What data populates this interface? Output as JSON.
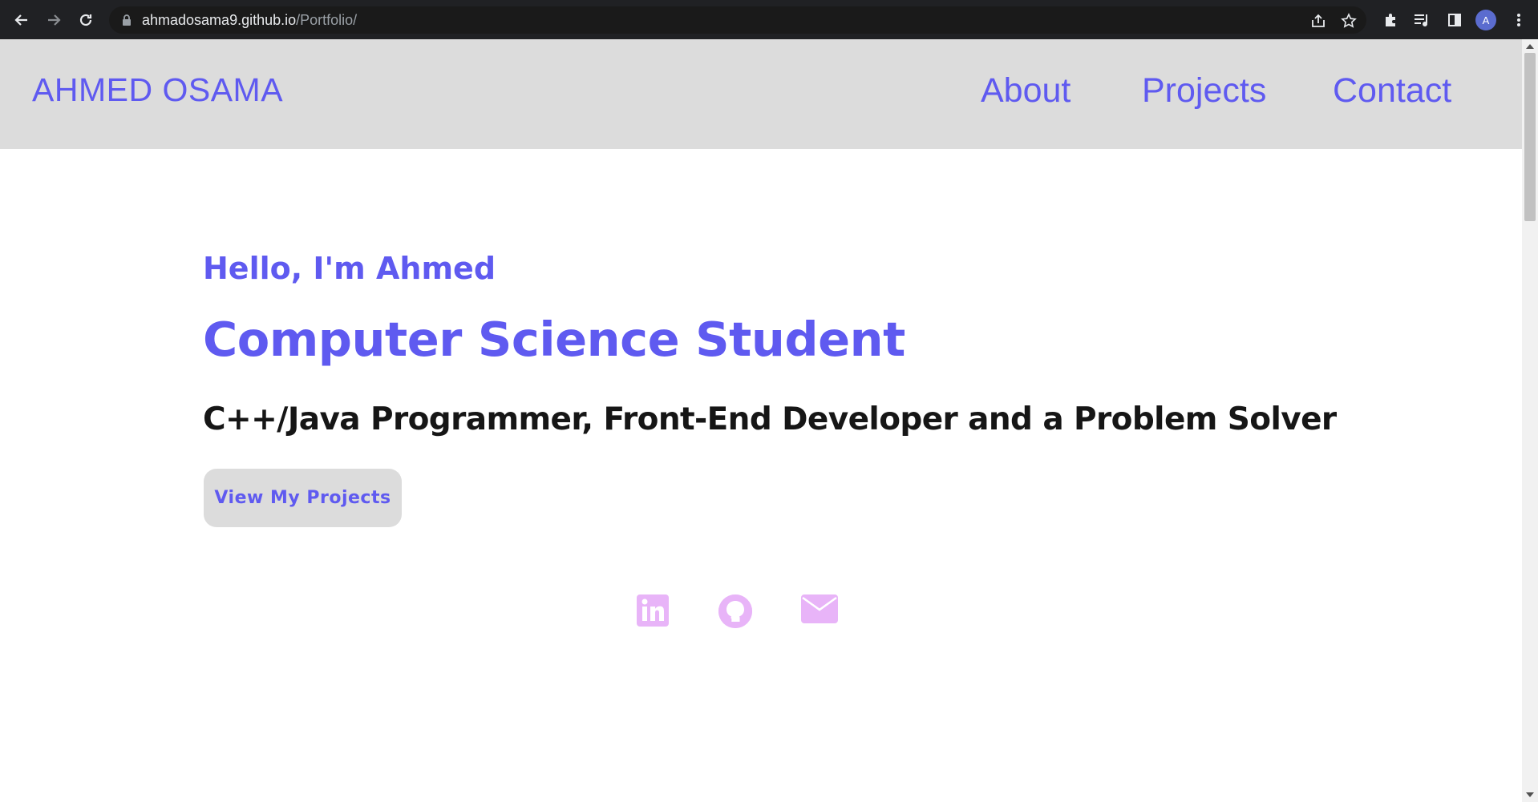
{
  "browser": {
    "url_host": "ahmadosama9.github.io",
    "url_path": "/Portfolio/",
    "profile_initial": "A"
  },
  "site": {
    "logo": "AHMED OSAMA",
    "nav": [
      {
        "label": "About"
      },
      {
        "label": "Projects"
      },
      {
        "label": "Contact"
      }
    ]
  },
  "hero": {
    "greeting": "Hello, I'm Ahmed",
    "title": "Computer Science Student",
    "subtitle": "C++/Java Programmer, Front-End Developer and a Problem Solver",
    "cta_label": "View My Projects"
  },
  "social": [
    {
      "icon": "linkedin-icon"
    },
    {
      "icon": "github-icon"
    },
    {
      "icon": "mail-icon"
    }
  ],
  "colors": {
    "accent": "#5f5af0",
    "nav_bg": "#dcdcdc",
    "social_icon": "#e8b4f8",
    "subtitle": "#161616"
  }
}
